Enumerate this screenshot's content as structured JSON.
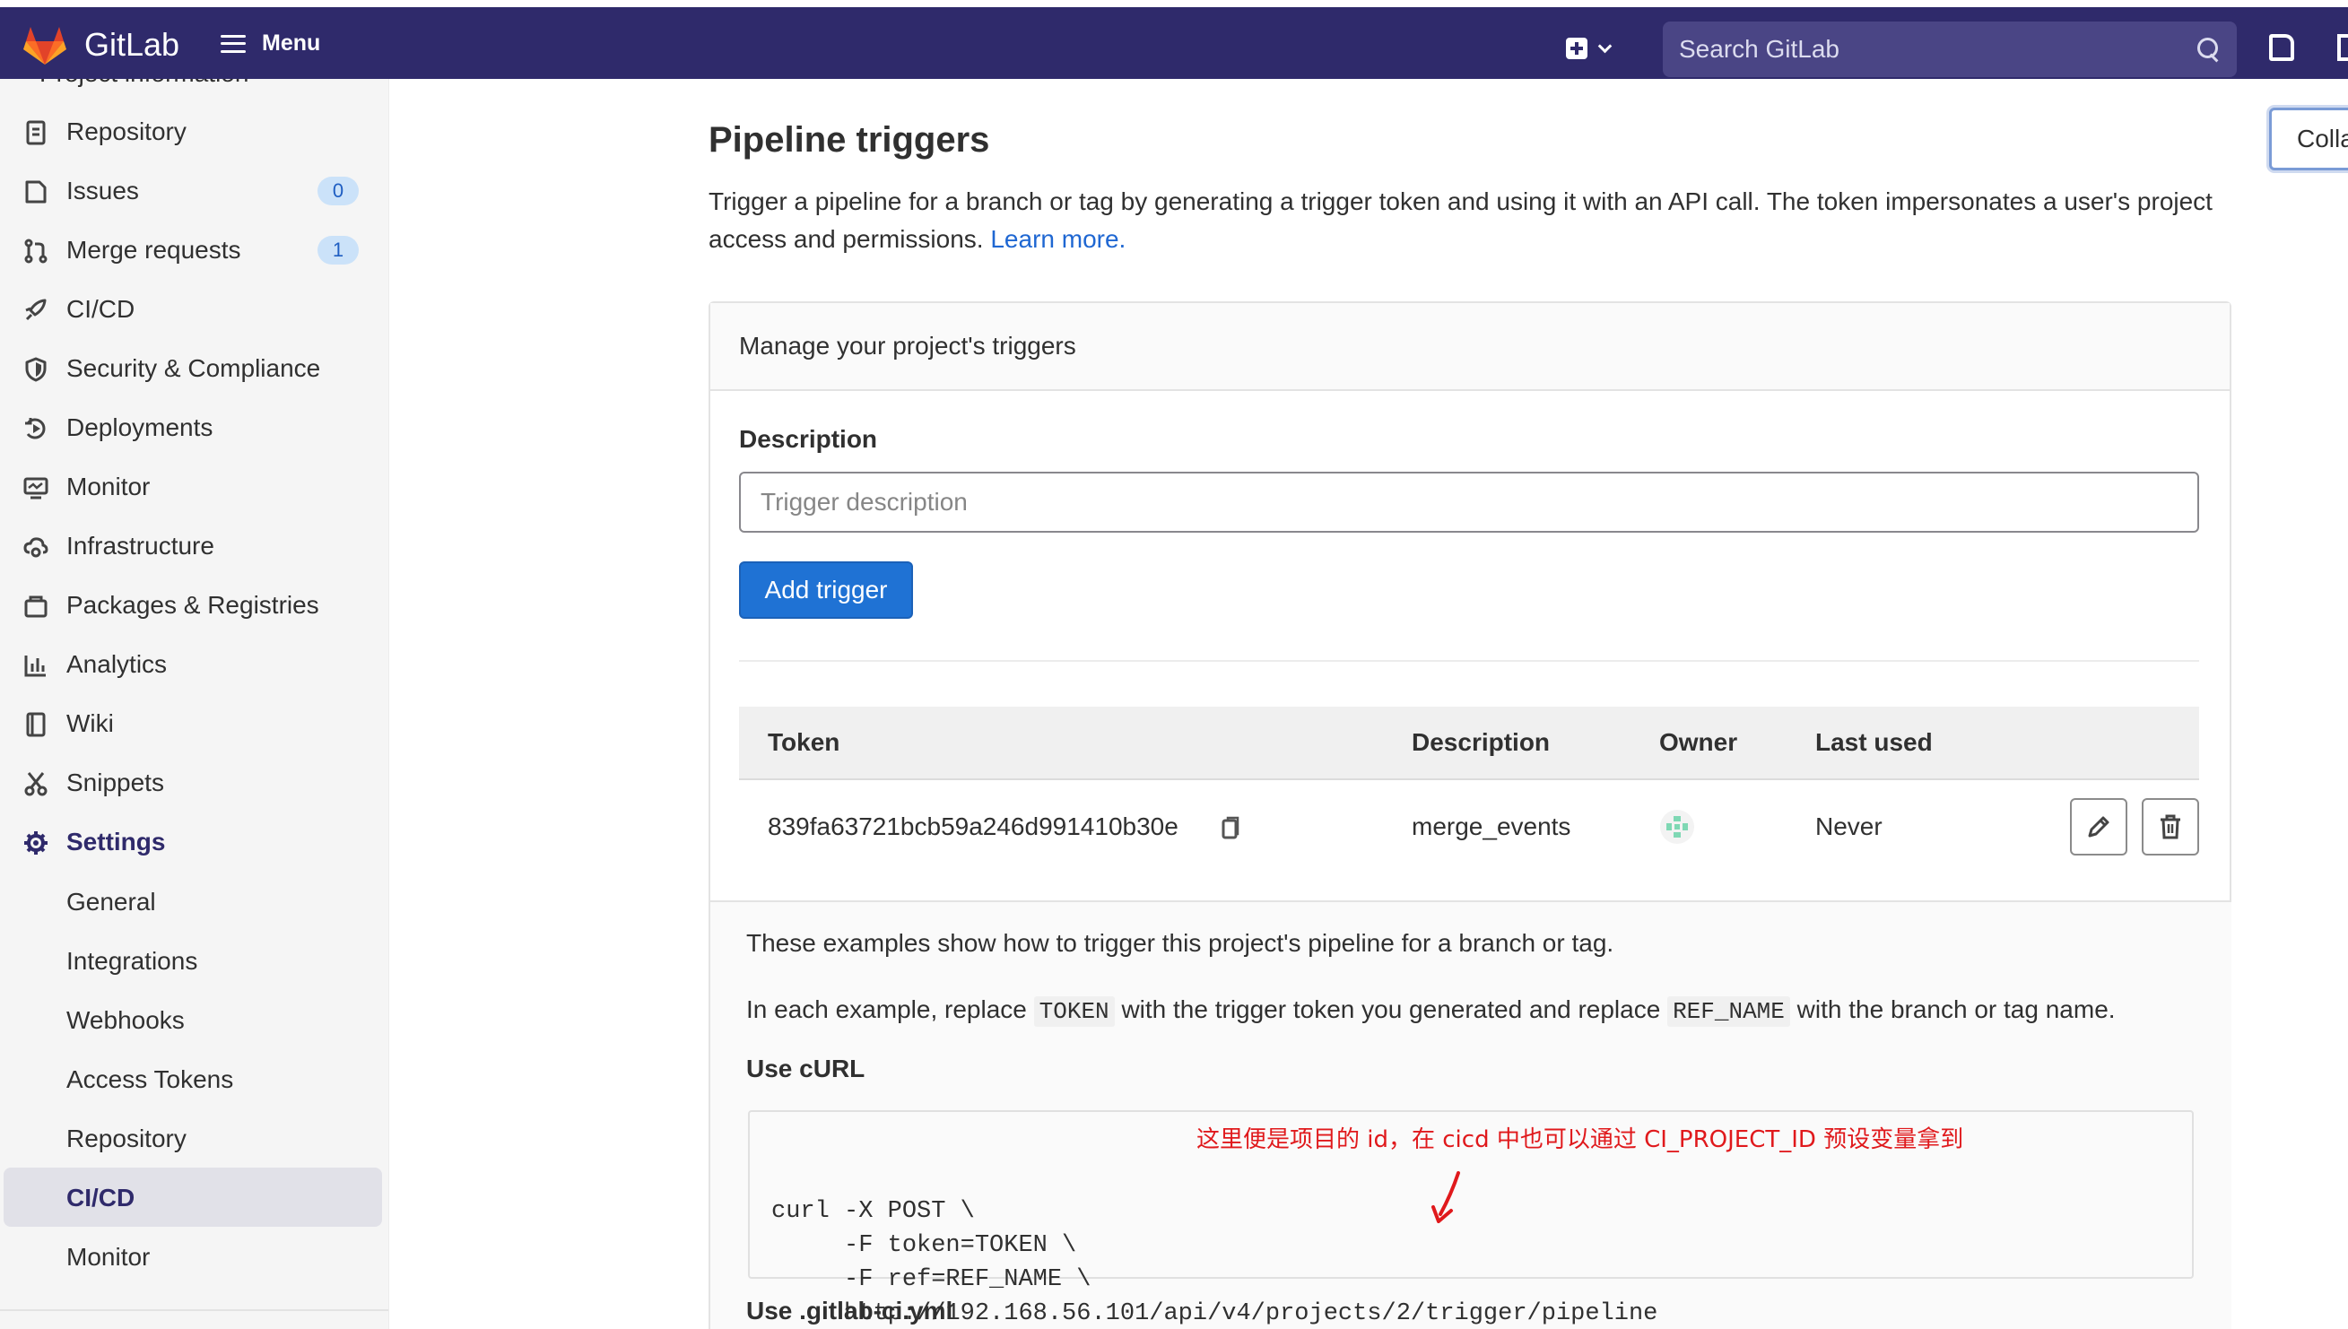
{
  "app": {
    "name": "GitLab",
    "menu_label": "Menu",
    "search_placeholder": "Search GitLab",
    "collapse_label": "Collapse"
  },
  "sidebar": {
    "cut_item": "Project information",
    "items": [
      {
        "label": "Repository",
        "icon": "repository-icon"
      },
      {
        "label": "Issues",
        "icon": "issues-icon",
        "badge": "0"
      },
      {
        "label": "Merge requests",
        "icon": "merge-request-icon",
        "badge": "1"
      },
      {
        "label": "CI/CD",
        "icon": "rocket-icon"
      },
      {
        "label": "Security & Compliance",
        "icon": "shield-icon"
      },
      {
        "label": "Deployments",
        "icon": "deployments-icon"
      },
      {
        "label": "Monitor",
        "icon": "monitor-icon"
      },
      {
        "label": "Infrastructure",
        "icon": "cloud-gear-icon"
      },
      {
        "label": "Packages & Registries",
        "icon": "package-icon"
      },
      {
        "label": "Analytics",
        "icon": "analytics-icon"
      },
      {
        "label": "Wiki",
        "icon": "book-icon"
      },
      {
        "label": "Snippets",
        "icon": "scissors-icon"
      },
      {
        "label": "Settings",
        "icon": "gear-icon"
      }
    ],
    "settings_sub": [
      "General",
      "Integrations",
      "Webhooks",
      "Access Tokens",
      "Repository",
      "CI/CD",
      "Monitor"
    ],
    "active_sub": "CI/CD"
  },
  "page": {
    "title": "Pipeline triggers",
    "description": "Trigger a pipeline for a branch or tag by generating a trigger token and using it with an API call. The token impersonates a user's project access and permissions.",
    "learn_more": "Learn more."
  },
  "card": {
    "header": "Manage your project's triggers",
    "description_label": "Description",
    "description_placeholder": "Trigger description",
    "add_button": "Add trigger",
    "columns": [
      "Token",
      "Description",
      "Owner",
      "Last used"
    ],
    "rows": [
      {
        "token": "839fa63721bcb59a246d991410b30e",
        "description": "merge_events",
        "last_used": "Never"
      }
    ]
  },
  "examples": {
    "intro": "These examples show how to trigger this project's pipeline for a branch or tag.",
    "replace_prefix": "In each example, replace",
    "token_code": "TOKEN",
    "replace_mid": "with the trigger token you generated and replace",
    "ref_code": "REF_NAME",
    "replace_suffix": "with the branch or tag name.",
    "curl_heading": "Use cURL",
    "curl_code": "curl -X POST \\\n     -F token=TOKEN \\\n     -F ref=REF_NAME \\\n     http://192.168.56.101/api/v4/projects/2/trigger/pipeline",
    "annotation": "这里便是项目的 id，在 cicd 中也可以通过 CI_PROJECT_ID 预设变量拿到",
    "yml_heading": "Use .gitlab-ci.yml"
  },
  "colors": {
    "topbar": "#2f2a6b",
    "primary_button": "#1f72d4",
    "link": "#1f67d2",
    "annotation": "#e0191c"
  }
}
